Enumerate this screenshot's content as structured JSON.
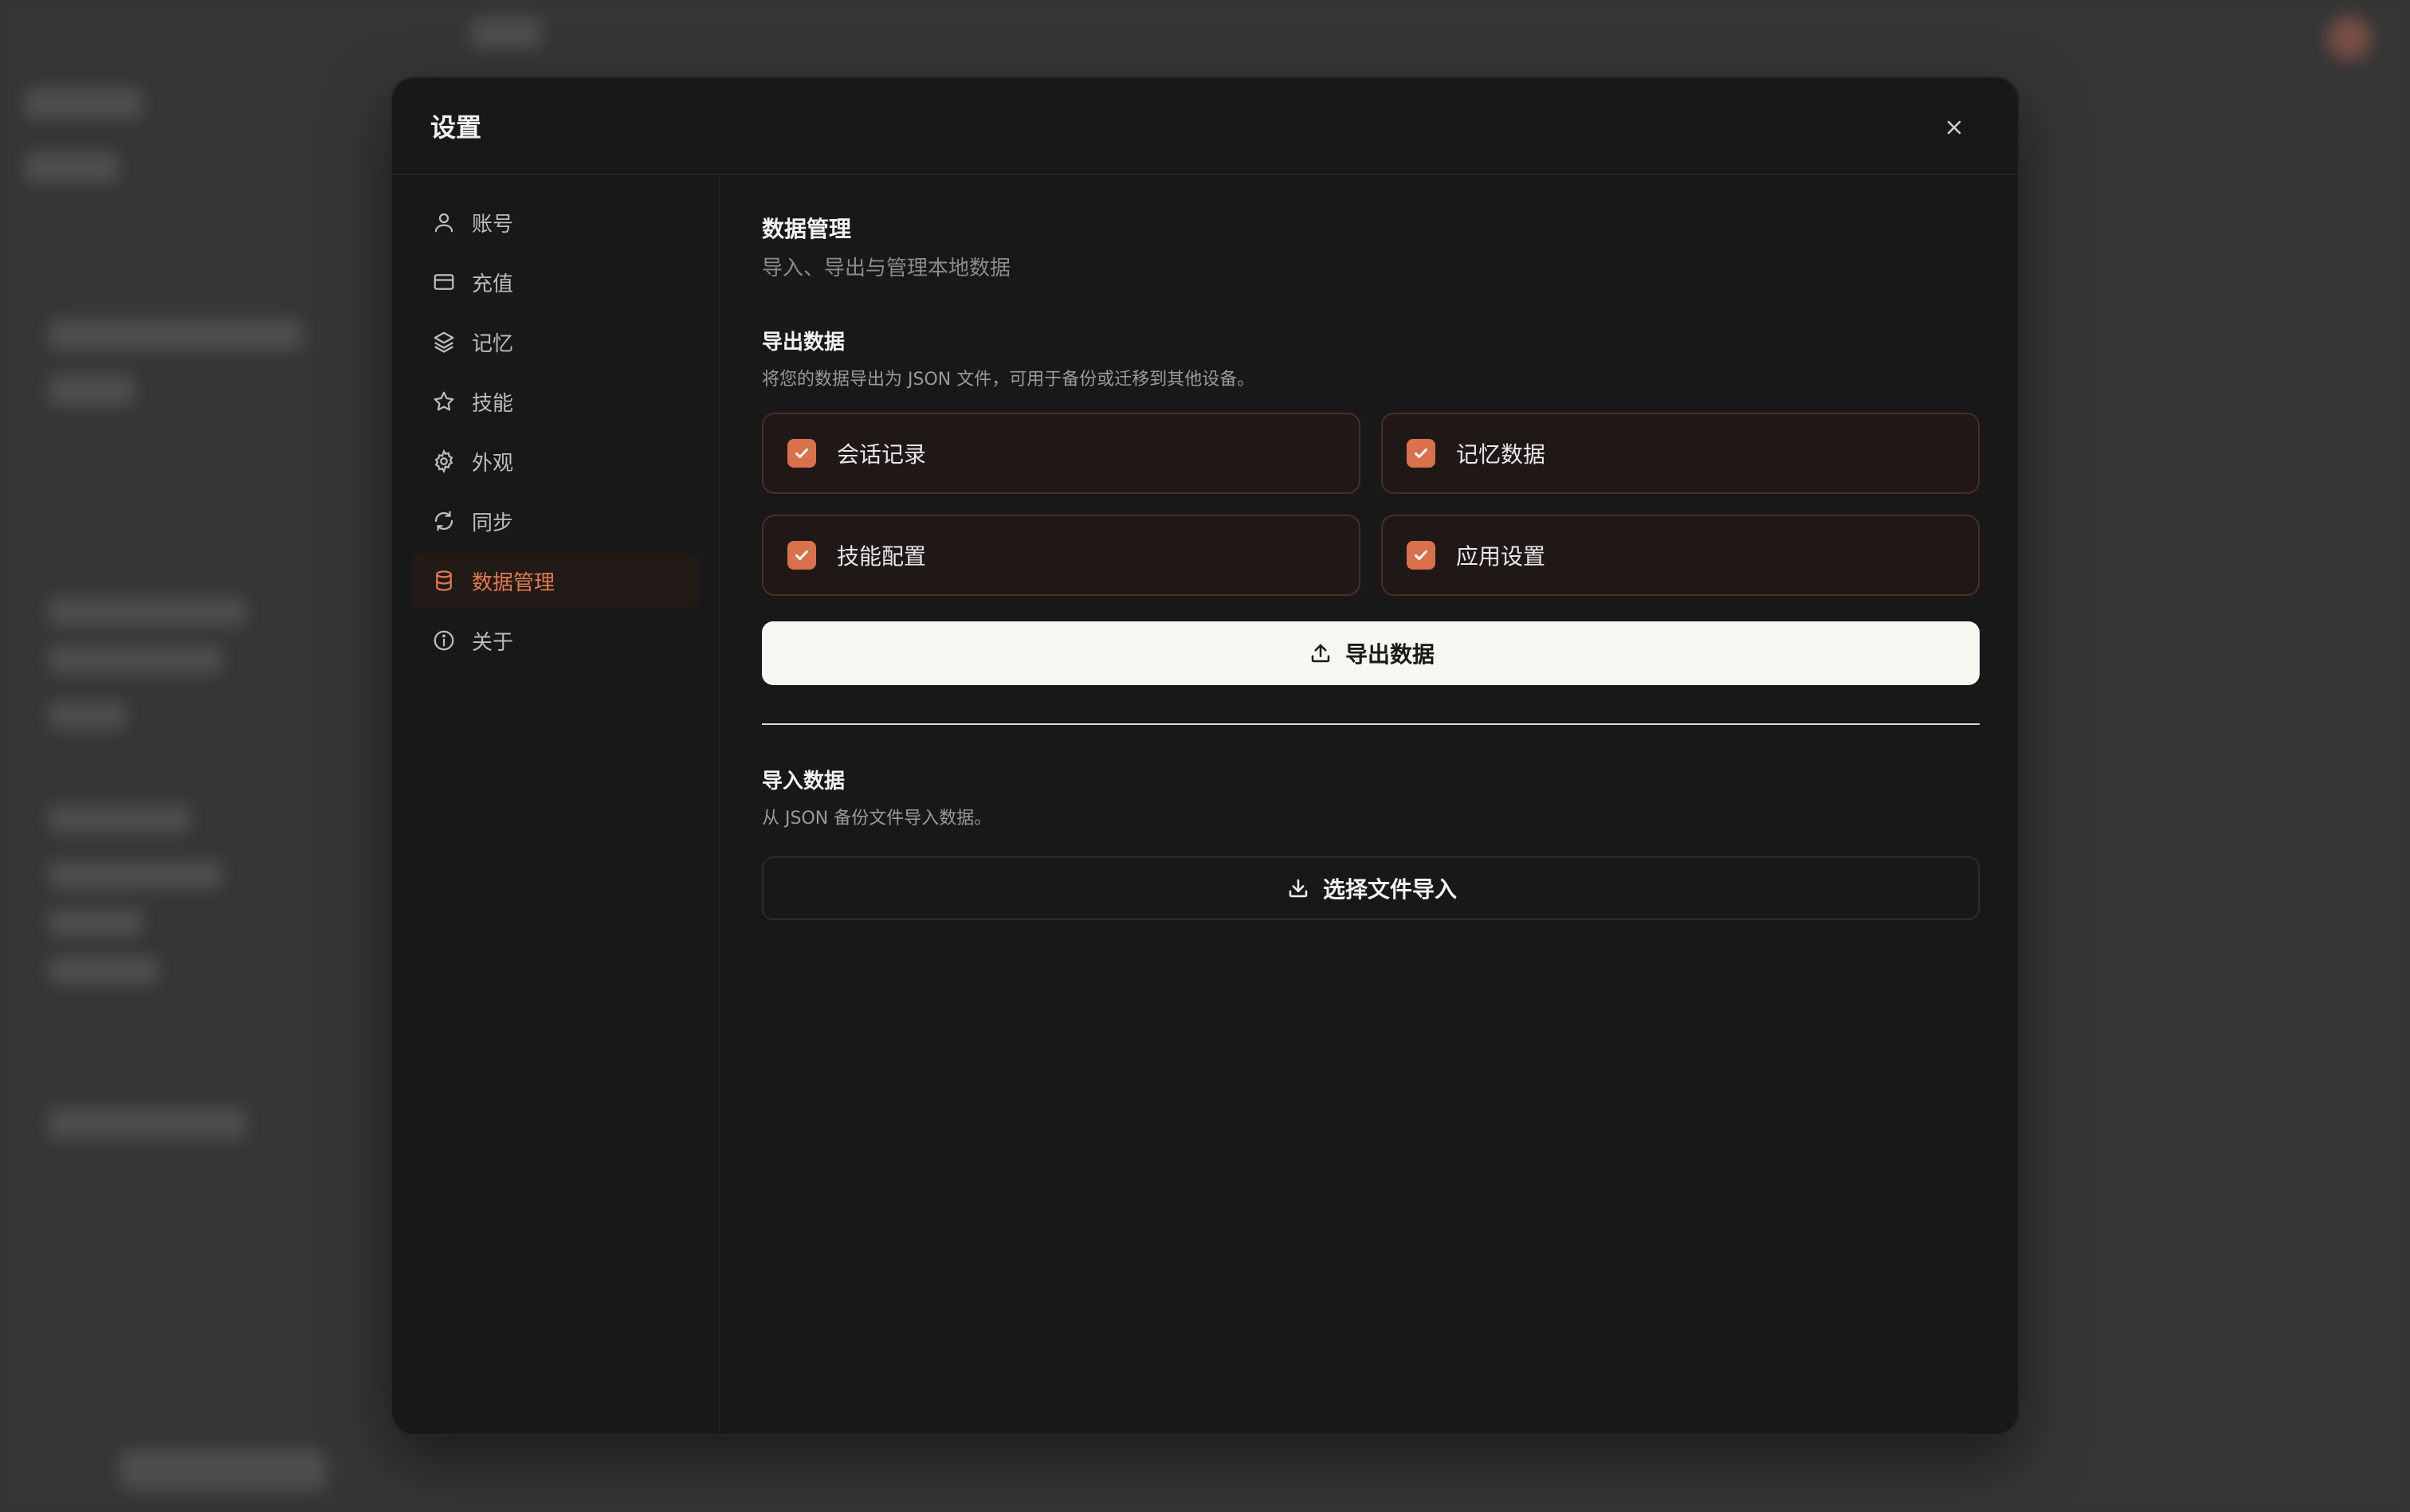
{
  "dialog": {
    "title": "设置"
  },
  "sidebar": {
    "items": [
      {
        "label": "账号",
        "icon": "user-icon"
      },
      {
        "label": "充值",
        "icon": "credit-card-icon"
      },
      {
        "label": "记忆",
        "icon": "layers-icon"
      },
      {
        "label": "技能",
        "icon": "star-icon"
      },
      {
        "label": "外观",
        "icon": "gear-icon"
      },
      {
        "label": "同步",
        "icon": "refresh-icon"
      },
      {
        "label": "数据管理",
        "icon": "database-icon",
        "active": true
      },
      {
        "label": "关于",
        "icon": "info-icon"
      }
    ]
  },
  "content": {
    "title": "数据管理",
    "subtitle": "导入、导出与管理本地数据",
    "export": {
      "title": "导出数据",
      "desc": "将您的数据导出为 JSON 文件，可用于备份或迁移到其他设备。",
      "options": [
        {
          "label": "会话记录",
          "checked": true
        },
        {
          "label": "记忆数据",
          "checked": true
        },
        {
          "label": "技能配置",
          "checked": true
        },
        {
          "label": "应用设置",
          "checked": true
        }
      ],
      "button": "导出数据"
    },
    "import": {
      "title": "导入数据",
      "desc": "从 JSON 备份文件导入数据。",
      "button": "选择文件导入"
    }
  },
  "colors": {
    "accent": "#d9714d",
    "active_text": "#e07a52",
    "dialog_bg": "#181818"
  }
}
